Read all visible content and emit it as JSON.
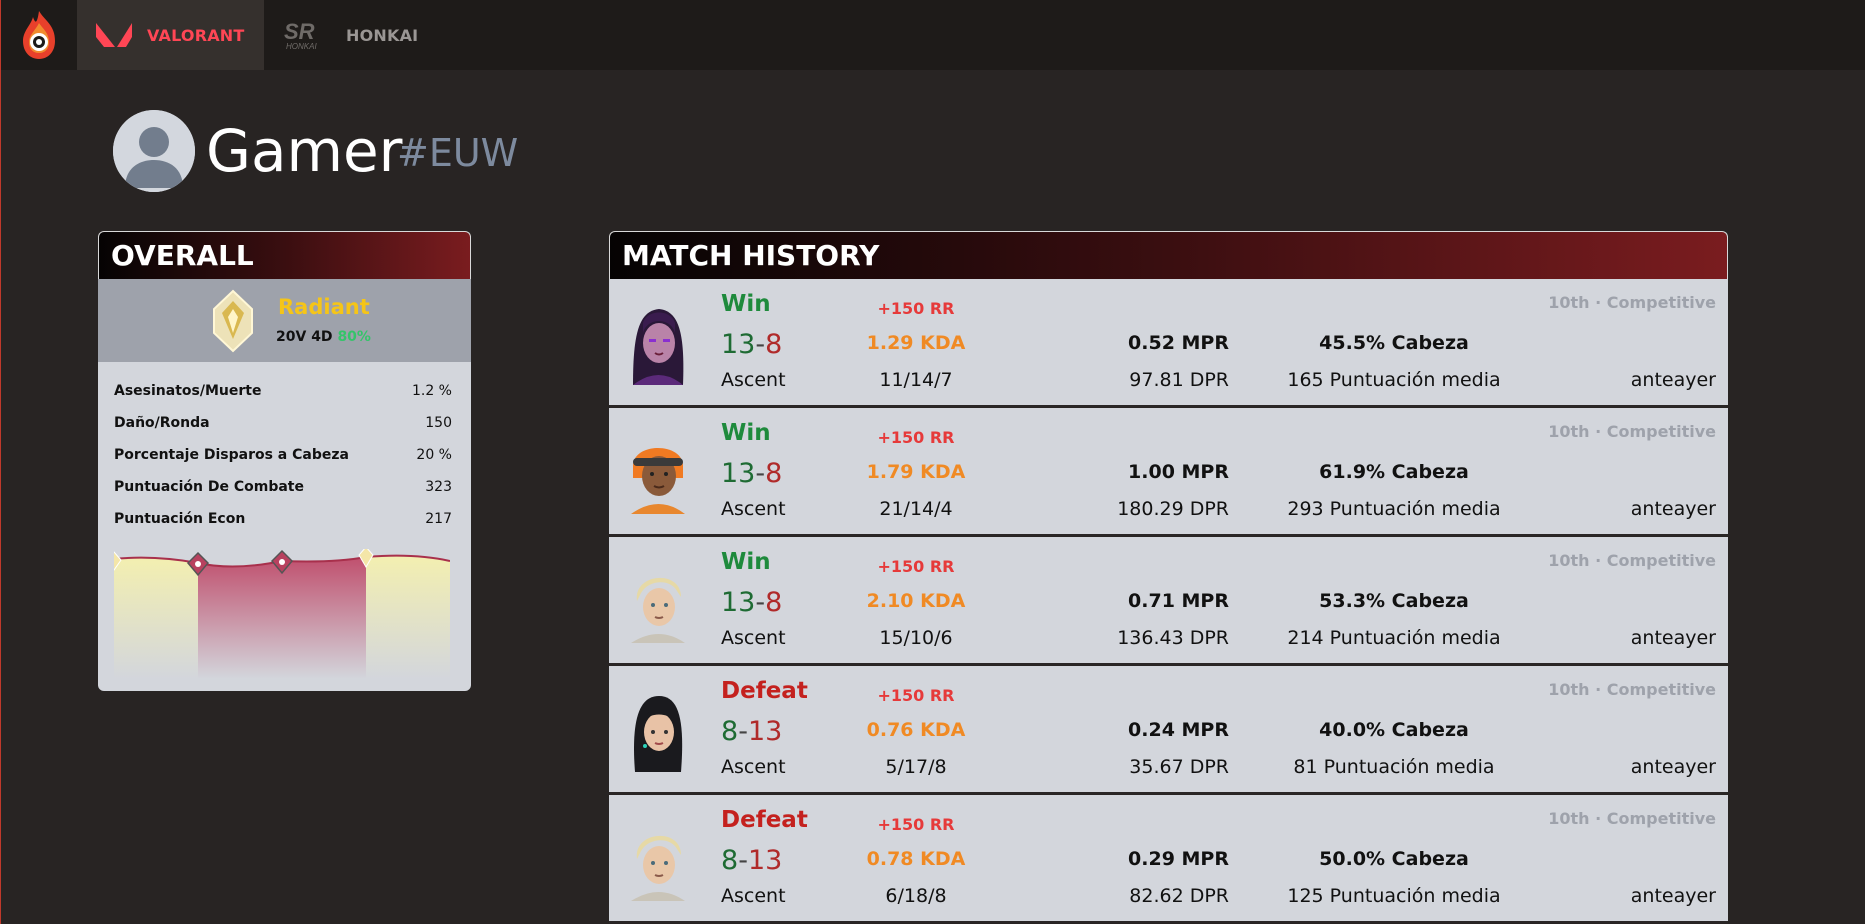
{
  "nav": {
    "tabs": [
      {
        "label": "VALORANT",
        "icon": "valorant-logo-icon",
        "active": true
      },
      {
        "label": "HONKAI",
        "icon": "honkai-logo-icon",
        "active": false
      }
    ],
    "logo_icon": "flame-target-icon"
  },
  "profile": {
    "name": "Gamer",
    "tag": "#EUW",
    "avatar_icon": "default-user-avatar-icon"
  },
  "overall": {
    "title": "OVERALL",
    "rank": {
      "name": "Radiant",
      "record": "20V 4D",
      "winrate": "80%",
      "icon": "radiant-rank-icon",
      "color": "#f5c518"
    },
    "stats": [
      {
        "label": "Asesinatos/Muerte",
        "value": "1.2 %"
      },
      {
        "label": "Daño/Ronda",
        "value": "150"
      },
      {
        "label": "Porcentaje Disparos a Cabeza",
        "value": "20 %"
      },
      {
        "label": "Puntuación De Combate",
        "value": "323"
      },
      {
        "label": "Puntuación Econ",
        "value": "217"
      }
    ]
  },
  "history": {
    "title": "MATCH HISTORY",
    "matches": [
      {
        "result": "Win",
        "outcome": "win",
        "score_a": "13",
        "score_b": "8",
        "map": "Ascent",
        "rr": "+150 RR",
        "kda": "1.29 KDA",
        "kills": "11/14/7",
        "mpr": "0.52 MPR",
        "dpr": "97.81 DPR",
        "hs": "45.5% Cabeza",
        "avg_score": "165 Puntuación media",
        "queue": "10th · Competitive",
        "time": "anteayer",
        "agent_icon": "agent-reyna-portrait"
      },
      {
        "result": "Win",
        "outcome": "win",
        "score_a": "13",
        "score_b": "8",
        "map": "Ascent",
        "rr": "+150 RR",
        "kda": "1.79 KDA",
        "kills": "21/14/4",
        "mpr": "1.00 MPR",
        "dpr": "180.29 DPR",
        "hs": "61.9% Cabeza",
        "avg_score": "293 Puntuación media",
        "queue": "10th · Competitive",
        "time": "anteayer",
        "agent_icon": "agent-raze-portrait"
      },
      {
        "result": "Win",
        "outcome": "win",
        "score_a": "13",
        "score_b": "8",
        "map": "Ascent",
        "rr": "+150 RR",
        "kda": "2.10 KDA",
        "kills": "15/10/6",
        "mpr": "0.71 MPR",
        "dpr": "136.43 DPR",
        "hs": "53.3% Cabeza",
        "avg_score": "214 Puntuación media",
        "queue": "10th · Competitive",
        "time": "anteayer",
        "agent_icon": "agent-chamber-portrait"
      },
      {
        "result": "Defeat",
        "outcome": "defeat",
        "score_a": "8",
        "score_b": "13",
        "map": "Ascent",
        "rr": "+150 RR",
        "kda": "0.76 KDA",
        "kills": "5/17/8",
        "mpr": "0.24 MPR",
        "dpr": "35.67 DPR",
        "hs": "40.0% Cabeza",
        "avg_score": "81 Puntuación media",
        "queue": "10th · Competitive",
        "time": "anteayer",
        "agent_icon": "agent-sage-portrait"
      },
      {
        "result": "Defeat",
        "outcome": "defeat",
        "score_a": "8",
        "score_b": "13",
        "map": "Ascent",
        "rr": "+150 RR",
        "kda": "0.78 KDA",
        "kills": "6/18/8",
        "mpr": "0.29 MPR",
        "dpr": "82.62 DPR",
        "hs": "50.0% Cabeza",
        "avg_score": "125 Puntuación media",
        "queue": "10th · Competitive",
        "time": "anteayer",
        "agent_icon": "agent-chamber-portrait"
      }
    ]
  },
  "colors": {
    "background": "#282423",
    "topbar": "#1e1b19",
    "accent_red": "#ff4655",
    "win": "#1e8a3c",
    "defeat": "#c4211e",
    "kda": "#f08a24",
    "rank_gold": "#f5c518",
    "winrate_green": "#35c46a"
  }
}
